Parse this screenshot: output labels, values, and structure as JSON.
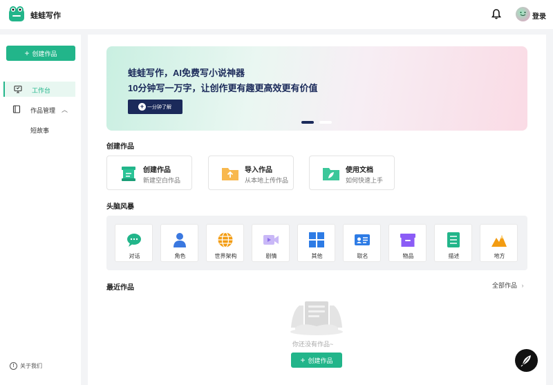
{
  "header": {
    "app_name": "蛙蛙写作",
    "login_label": "登录"
  },
  "sidebar": {
    "create_button": "创建作品",
    "items": [
      {
        "label": "工作台",
        "active": true
      },
      {
        "label": "作品管理",
        "expanded": true
      }
    ],
    "sub_items": [
      "短故事"
    ],
    "about_label": "关于我们"
  },
  "banner": {
    "line1": "蛙蛙写作，AI免费写小说神器",
    "line2": "10分钟写一万字，让创作更有趣更高效更有价值",
    "button_label": "一分钟了解"
  },
  "create_section": {
    "title": "创建作品",
    "cards": [
      {
        "title": "创建作品",
        "subtitle": "新建空白作品",
        "icon": "scroll-icon",
        "color": "#22b58a"
      },
      {
        "title": "导入作品",
        "subtitle": "从本地上传作品",
        "icon": "upload-folder-icon",
        "color": "#f8b84e"
      },
      {
        "title": "使用文档",
        "subtitle": "如何快速上手",
        "icon": "leaf-folder-icon",
        "color": "#3cc79a"
      }
    ]
  },
  "brainstorm": {
    "title": "头脑风暴",
    "tiles": [
      {
        "label": "对话",
        "icon": "chat-bubble-icon",
        "color": "#22b58a"
      },
      {
        "label": "角色",
        "icon": "person-icon",
        "color": "#3a78e0"
      },
      {
        "label": "世界架构",
        "icon": "globe-icon",
        "color": "#f39c12"
      },
      {
        "label": "剧情",
        "icon": "video-icon",
        "color": "#8b6ee8"
      },
      {
        "label": "其他",
        "icon": "grid-icon",
        "color": "#2d7be5"
      },
      {
        "label": "取名",
        "icon": "id-card-icon",
        "color": "#2d7be5"
      },
      {
        "label": "物品",
        "icon": "box-icon",
        "color": "#8b5cf6"
      },
      {
        "label": "描述",
        "icon": "document-icon",
        "color": "#22b58a"
      },
      {
        "label": "地方",
        "icon": "mountain-icon",
        "color": "#f39c12"
      }
    ]
  },
  "recent": {
    "title": "最近作品",
    "all_label": "全部作品",
    "empty_text": "你还没有作品~",
    "create_button": "创建作品"
  }
}
